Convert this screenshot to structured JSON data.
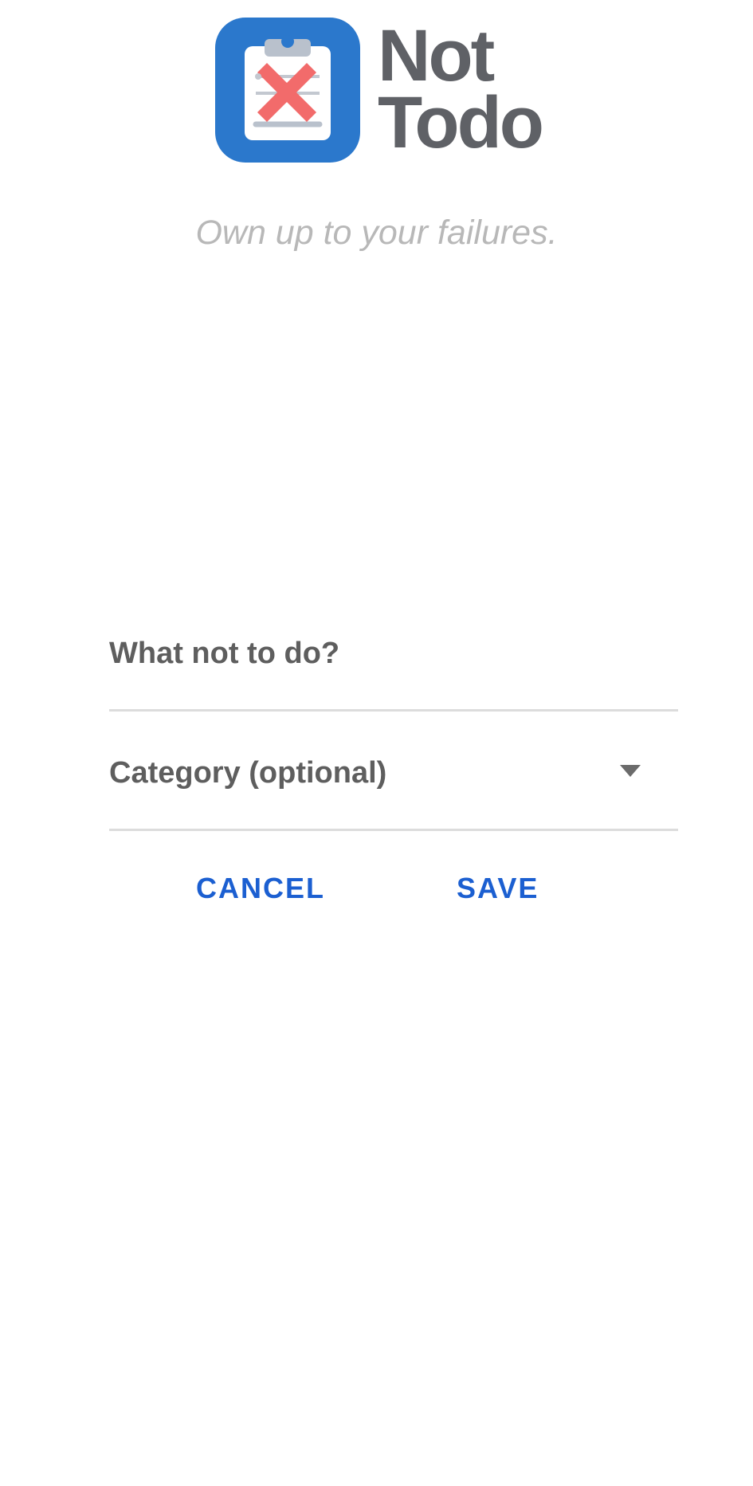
{
  "app": {
    "logo_line1": "Not",
    "logo_line2": "Todo",
    "tagline": "Own up to your failures."
  },
  "form": {
    "what_label": "What not to do?",
    "category_label": "Category (optional)",
    "cancel_label": "CANCEL",
    "save_label": "SAVE"
  },
  "colors": {
    "logo_blue": "#2b78cc",
    "logo_red": "#f26b6b",
    "button_blue": "#1b5fd1",
    "text_gray": "#5e5e5e",
    "tagline_gray": "#b8b8b8",
    "divider_gray": "#dcdcdc"
  },
  "icons": {
    "logo": "clipboard-x-icon",
    "dropdown": "caret-down-icon"
  }
}
